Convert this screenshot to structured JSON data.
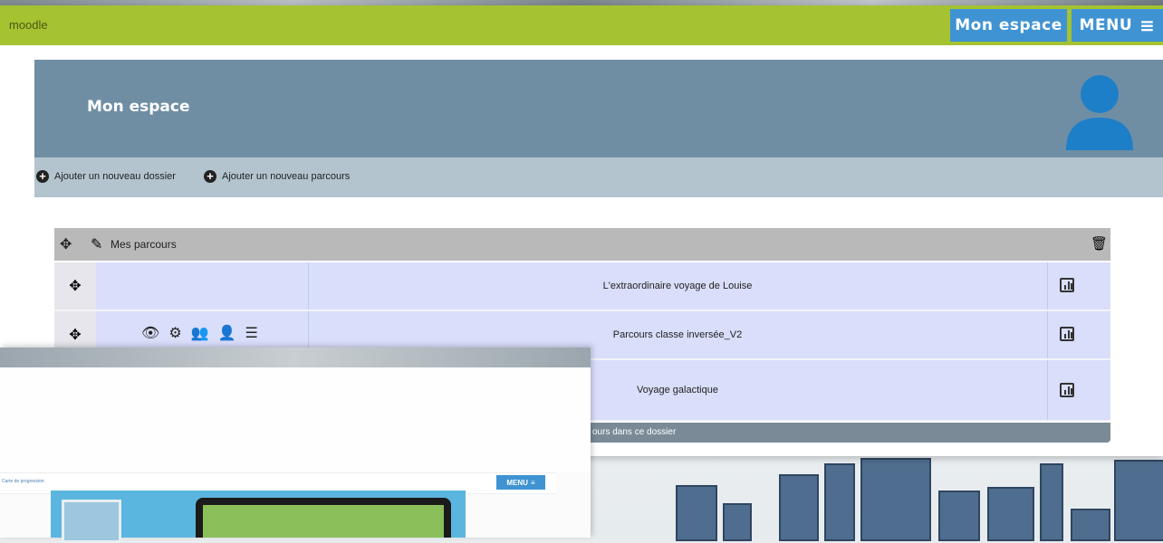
{
  "app_name": "moodle",
  "topbar": {
    "space_label": "Mon espace",
    "menu_label": "MENU"
  },
  "header": {
    "title": "Mon espace"
  },
  "actions": {
    "add_folder": "Ajouter un nouveau dossier",
    "add_course": "Ajouter un nouveau parcours"
  },
  "folder": {
    "name": "Mes parcours"
  },
  "rows": [
    {
      "title": "L'extraordinaire voyage de Louise"
    },
    {
      "title": "Parcours classe inversée_V2"
    },
    {
      "title": "Voyage galactique"
    }
  ],
  "footer_text": "ours dans ce dossier",
  "back_window": {
    "breadcrumb": "Carte de progression",
    "menu_label": "MENU"
  },
  "colors": {
    "topbar": "#a5c231",
    "button": "#3f93d3",
    "header": "#6f8ea4",
    "row": "#d9defa"
  }
}
